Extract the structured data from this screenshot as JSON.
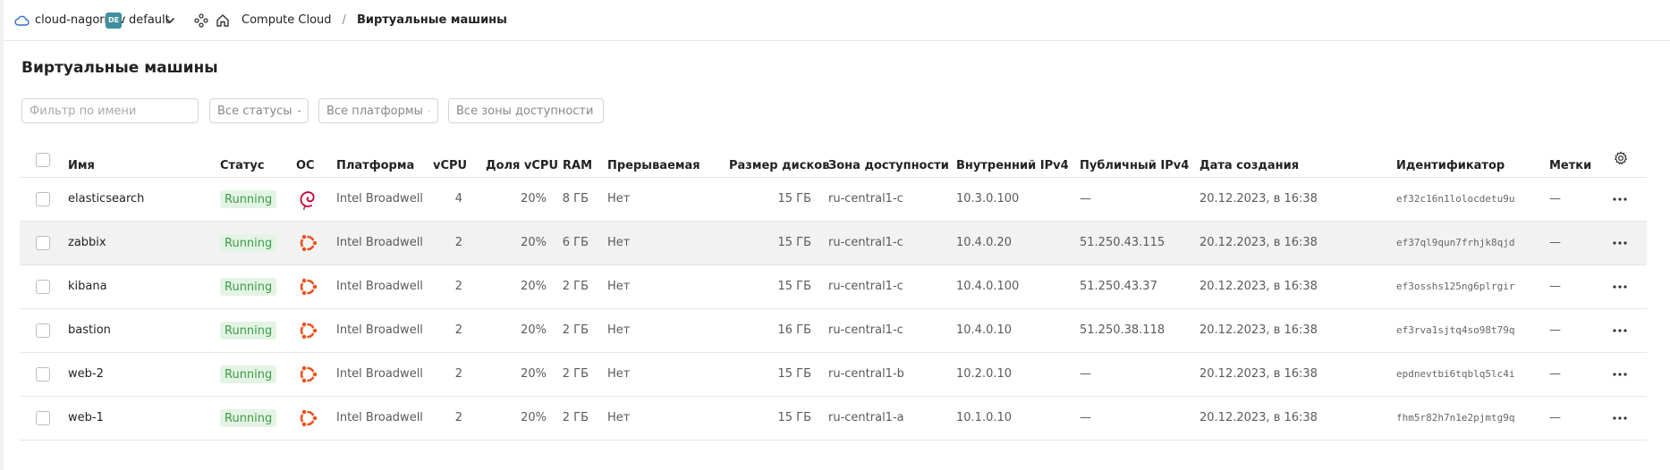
{
  "topbar": {
    "cloud_name": "cloud-nagornov",
    "folder_badge": "DE",
    "folder_name": "default",
    "service": "Compute Cloud",
    "separator": "/",
    "current_page": "Виртуальные машины"
  },
  "page": {
    "title": "Виртуальные машины"
  },
  "filters": {
    "name_placeholder": "Фильтр по имени",
    "status": "Все статусы",
    "platform": "Все платформы",
    "zone": "Все зоны доступности"
  },
  "columns": {
    "name": "Имя",
    "status": "Статус",
    "os": "ОС",
    "platform": "Платформа",
    "vcpu": "vCPU",
    "vcpu_share": "Доля vCPU",
    "ram": "RAM",
    "preemptible": "Прерываемая",
    "disk_size": "Размер дисков",
    "zone": "Зона доступности",
    "internal_ip": "Внутренний IPv4",
    "public_ip": "Публичный IPv4",
    "created": "Дата создания",
    "id": "Идентификатор",
    "labels": "Метки"
  },
  "rows": [
    {
      "name": "elasticsearch",
      "status": "Running",
      "os": "debian-icon",
      "platform": "Intel Broadwell",
      "vcpu": "4",
      "vcpu_share": "20%",
      "ram": "8 ГБ",
      "preemptible": "Нет",
      "disk": "15 ГБ",
      "zone": "ru-central1-c",
      "internal_ip": "10.3.0.100",
      "public_ip": "—",
      "created": "20.12.2023, в 16:38",
      "id": "ef32c16n1lolocdetu9u",
      "labels": "—"
    },
    {
      "name": "zabbix",
      "status": "Running",
      "os": "ubuntu-icon",
      "platform": "Intel Broadwell",
      "vcpu": "2",
      "vcpu_share": "20%",
      "ram": "6 ГБ",
      "preemptible": "Нет",
      "disk": "15 ГБ",
      "zone": "ru-central1-c",
      "internal_ip": "10.4.0.20",
      "public_ip": "51.250.43.115",
      "created": "20.12.2023, в 16:38",
      "id": "ef37ql9qun7frhjk8qjd",
      "labels": "—"
    },
    {
      "name": "kibana",
      "status": "Running",
      "os": "ubuntu-icon",
      "platform": "Intel Broadwell",
      "vcpu": "2",
      "vcpu_share": "20%",
      "ram": "2 ГБ",
      "preemptible": "Нет",
      "disk": "15 ГБ",
      "zone": "ru-central1-c",
      "internal_ip": "10.4.0.100",
      "public_ip": "51.250.43.37",
      "created": "20.12.2023, в 16:38",
      "id": "ef3osshs125ng6plrgir",
      "labels": "—"
    },
    {
      "name": "bastion",
      "status": "Running",
      "os": "ubuntu-icon",
      "platform": "Intel Broadwell",
      "vcpu": "2",
      "vcpu_share": "20%",
      "ram": "2 ГБ",
      "preemptible": "Нет",
      "disk": "16 ГБ",
      "zone": "ru-central1-c",
      "internal_ip": "10.4.0.10",
      "public_ip": "51.250.38.118",
      "created": "20.12.2023, в 16:38",
      "id": "ef3rva1sjtq4so98t79q",
      "labels": "—"
    },
    {
      "name": "web-2",
      "status": "Running",
      "os": "ubuntu-icon",
      "platform": "Intel Broadwell",
      "vcpu": "2",
      "vcpu_share": "20%",
      "ram": "2 ГБ",
      "preemptible": "Нет",
      "disk": "15 ГБ",
      "zone": "ru-central1-b",
      "internal_ip": "10.2.0.10",
      "public_ip": "—",
      "created": "20.12.2023, в 16:38",
      "id": "epdnevtbi6tqblq5lc4i",
      "labels": "—"
    },
    {
      "name": "web-1",
      "status": "Running",
      "os": "ubuntu-icon",
      "platform": "Intel Broadwell",
      "vcpu": "2",
      "vcpu_share": "20%",
      "ram": "2 ГБ",
      "preemptible": "Нет",
      "disk": "15 ГБ",
      "zone": "ru-central1-a",
      "internal_ip": "10.1.0.10",
      "public_ip": "—",
      "created": "20.12.2023, в 16:38",
      "id": "fhm5r82h7n1e2pjmtg9q",
      "labels": "—"
    }
  ],
  "colors": {
    "status_bg": "#e4f4e4",
    "status_text": "#3b9c47",
    "ubuntu": "#e95420",
    "debian": "#c70036",
    "cloud_icon": "#2f6fd1"
  }
}
